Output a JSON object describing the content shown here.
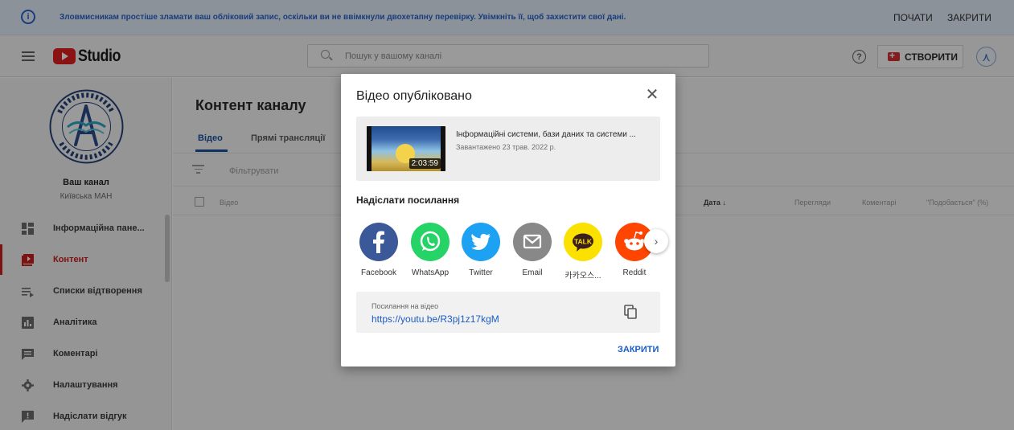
{
  "banner": {
    "message": "Зловмисникам простіше зламати ваш обліковий запис, оскільки ви не ввімкнули двохетапну перевірку. Увімкніть її, щоб захистити свої дані.",
    "start_label": "ПОЧАТИ",
    "close_label": "ЗАКРИТИ"
  },
  "header": {
    "logo_text": "Studio",
    "search_placeholder": "Пошук у вашому каналі",
    "create_label": "СТВОРИТИ"
  },
  "sidebar": {
    "channel_title": "Ваш канал",
    "channel_subtitle": "Київська МАН",
    "items": [
      {
        "label": "Інформаційна пане...",
        "icon": "dashboard-icon"
      },
      {
        "label": "Контент",
        "icon": "content-icon",
        "active": true
      },
      {
        "label": "Списки відтворення",
        "icon": "playlist-icon"
      },
      {
        "label": "Аналітика",
        "icon": "analytics-icon"
      },
      {
        "label": "Коментарі",
        "icon": "comments-icon"
      },
      {
        "label": "Налаштування",
        "icon": "settings-icon"
      },
      {
        "label": "Надіслати відгук",
        "icon": "feedback-icon"
      }
    ]
  },
  "main": {
    "page_title": "Контент каналу",
    "tabs": [
      {
        "label": "Відео",
        "active": true
      },
      {
        "label": "Прямі трансляції",
        "active": false
      }
    ],
    "filter_label": "Фільтрувати",
    "columns": {
      "video": "Відео",
      "date": "Дата ↓",
      "views": "Перегляди",
      "comments": "Коментарі",
      "likes": "\"Подобається\" (%)"
    }
  },
  "dialog": {
    "title": "Відео опубліковано",
    "video": {
      "title": "Інформаційні системи, бази даних та системи ...",
      "uploaded": "Завантажено 23 трав. 2022 р.",
      "duration": "2:03:59"
    },
    "share_title": "Надіслати посилання",
    "share_targets": [
      {
        "label": "Facebook",
        "color": "#3b5998",
        "icon": "facebook-icon"
      },
      {
        "label": "WhatsApp",
        "color": "#25d366",
        "icon": "whatsapp-icon"
      },
      {
        "label": "Twitter",
        "color": "#1da1f2",
        "icon": "twitter-icon"
      },
      {
        "label": "Email",
        "color": "#888888",
        "icon": "email-icon"
      },
      {
        "label": "카카오스...",
        "color": "#fae100",
        "icon": "kakaotalk-icon"
      },
      {
        "label": "Reddit",
        "color": "#ff4500",
        "icon": "reddit-icon"
      }
    ],
    "link_label": "Посилання на відео",
    "link_url": "https://youtu.be/R3pj1z17kgM",
    "close_label": "ЗАКРИТИ"
  }
}
